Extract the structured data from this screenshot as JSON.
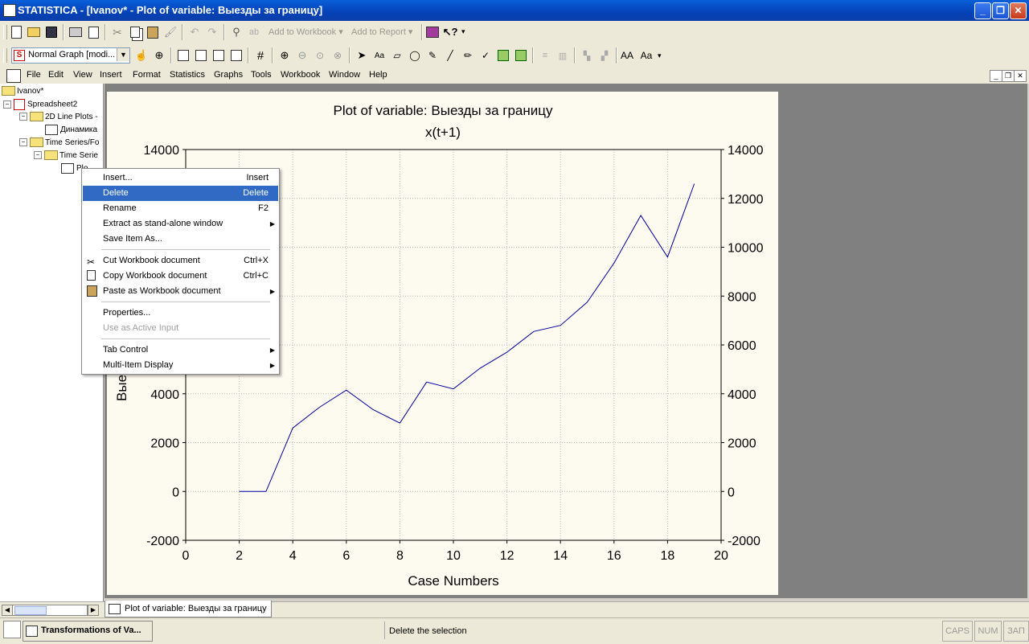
{
  "window": {
    "title": "STATISTICA - [Ivanov* - Plot of variable: Выезды за границу]"
  },
  "toolbar1": {
    "add_to_workbook": "Add to Workbook",
    "add_to_report": "Add to Report"
  },
  "toolbar2": {
    "graph_style_select": "Normal Graph [modi..."
  },
  "menu": [
    "File",
    "Edit",
    "View",
    "Insert",
    "Format",
    "Statistics",
    "Graphs",
    "Tools",
    "Workbook",
    "Window",
    "Help"
  ],
  "tree": {
    "root": "Ivanov*",
    "spreadsheet": "Spreadsheet2",
    "line_plots": "2D Line Plots -",
    "line_plot_item": "Динамика",
    "time_series": "Time Series/Fo",
    "time_series_sub": "Time Serie",
    "plot_item": "Plo"
  },
  "context_menu": {
    "items": [
      {
        "label": "Insert...",
        "shortcut": "Insert"
      },
      {
        "label": "Delete",
        "shortcut": "Delete"
      },
      {
        "label": "Rename",
        "shortcut": "F2"
      },
      {
        "label": "Extract as stand-alone window",
        "shortcut": ""
      },
      {
        "label": "Save Item As...",
        "shortcut": ""
      },
      {
        "label": "Cut Workbook document",
        "shortcut": "Ctrl+X"
      },
      {
        "label": "Copy Workbook document",
        "shortcut": "Ctrl+C"
      },
      {
        "label": "Paste as Workbook document",
        "shortcut": ""
      },
      {
        "label": "Properties...",
        "shortcut": ""
      },
      {
        "label": "Use as Active Input",
        "shortcut": ""
      },
      {
        "label": "Tab Control",
        "shortcut": ""
      },
      {
        "label": "Multi-Item Display",
        "shortcut": ""
      }
    ]
  },
  "chart_data": {
    "type": "line",
    "title": "Plot of variable: Выезды за границу",
    "subtitle": "x(t+1)",
    "xlabel": "Case Numbers",
    "ylabel": "Выезд",
    "xlim": [
      0,
      20
    ],
    "ylim": [
      -2000,
      14000
    ],
    "x_ticks": [
      0,
      2,
      4,
      6,
      8,
      10,
      12,
      14,
      16,
      18,
      20
    ],
    "y_ticks": [
      -2000,
      0,
      2000,
      4000,
      6000,
      8000,
      10000,
      12000,
      14000
    ],
    "grid": true,
    "color": "#0000a0",
    "x": [
      2,
      3,
      4,
      5,
      6,
      7,
      8,
      9,
      10,
      11,
      12,
      13,
      14,
      15,
      16,
      17,
      18,
      19
    ],
    "y": [
      0,
      0,
      2600,
      3450,
      4150,
      3350,
      2800,
      4480,
      4200,
      5050,
      5700,
      6550,
      6800,
      7750,
      9350,
      11300,
      9600,
      12600
    ]
  },
  "tabs": {
    "active_tab": "Plot of variable: Выезды за границу"
  },
  "statusbar": {
    "taskbar_button": "Transformations of Va...",
    "message": "Delete the selection",
    "caps": "CAPS",
    "num": "NUM",
    "zap": "ЗАП"
  }
}
